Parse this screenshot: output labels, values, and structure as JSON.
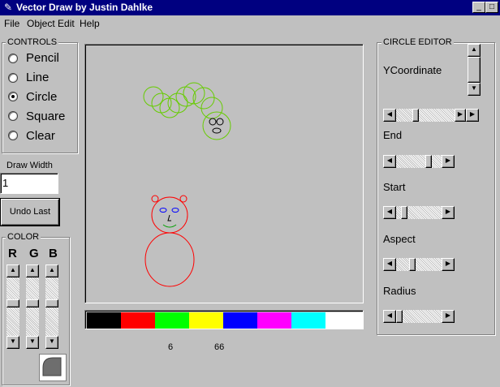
{
  "window": {
    "title": "Vector Draw by Justin Dahlke"
  },
  "menu": [
    "File",
    "Object Edit",
    "Help"
  ],
  "controls": {
    "label": "CONTROLS",
    "options": [
      "Pencil",
      "Line",
      "Circle",
      "Square",
      "Clear"
    ],
    "selected": "Circle"
  },
  "draw_width": {
    "label": "Draw Width",
    "value": "1"
  },
  "undo_button": "Undo Last",
  "color_group": {
    "label": "COLOR",
    "channels": [
      "R",
      "G",
      "B"
    ]
  },
  "palette": [
    "#000000",
    "#ff0000",
    "#00ff00",
    "#ffff00",
    "#0000ff",
    "#ff00ff",
    "#00ffff",
    "#ffffff"
  ],
  "readouts": {
    "first": "6",
    "second": "66"
  },
  "circle_editor": {
    "label": "CIRCLE EDITOR",
    "fields": [
      "YCoordinate",
      "End",
      "Start",
      "Aspect",
      "Radius"
    ]
  },
  "colors": {
    "titlebar": "#000080",
    "face": "#c0c0c0",
    "green_circles": "#66cc00",
    "red_figure": "#ff0000",
    "eyes": "#0000ff"
  }
}
